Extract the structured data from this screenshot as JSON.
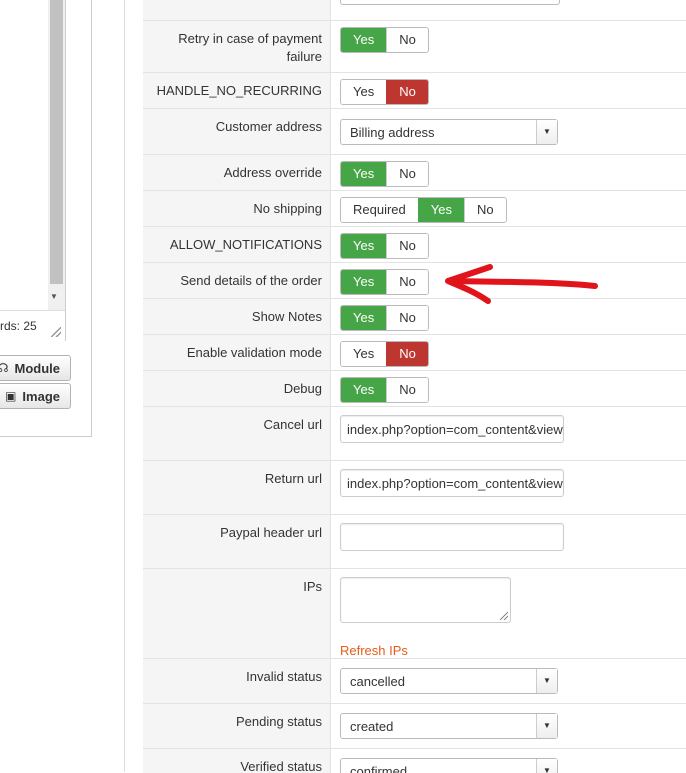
{
  "editor": {
    "words_text": "rds: 25",
    "buttons": [
      {
        "label": "Module",
        "icon": "module-icon"
      },
      {
        "label": "Image",
        "icon": "image-icon"
      }
    ]
  },
  "colors": {
    "yes_active": "#46a546",
    "no_active": "#bd362f",
    "annotation_arrow": "#e0141a",
    "link": "#e55e1a"
  },
  "form": {
    "retry": {
      "label": "Retry in case of payment failure",
      "options": [
        "Yes",
        "No"
      ],
      "selected": "Yes"
    },
    "handle_no_recurring": {
      "label": "HANDLE_NO_RECURRING",
      "options": [
        "Yes",
        "No"
      ],
      "selected": "No"
    },
    "customer_address": {
      "label": "Customer address",
      "value": "Billing address"
    },
    "address_override": {
      "label": "Address override",
      "options": [
        "Yes",
        "No"
      ],
      "selected": "Yes"
    },
    "no_shipping": {
      "label": "No shipping",
      "options": [
        "Required",
        "Yes",
        "No"
      ],
      "selected": "Yes"
    },
    "allow_notifications": {
      "label": "ALLOW_NOTIFICATIONS",
      "options": [
        "Yes",
        "No"
      ],
      "selected": "Yes"
    },
    "send_details": {
      "label": "Send details of the order",
      "options": [
        "Yes",
        "No"
      ],
      "selected": "Yes"
    },
    "show_notes": {
      "label": "Show Notes",
      "options": [
        "Yes",
        "No"
      ],
      "selected": "Yes"
    },
    "validation_mode": {
      "label": "Enable validation mode",
      "options": [
        "Yes",
        "No"
      ],
      "selected": "No"
    },
    "debug": {
      "label": "Debug",
      "options": [
        "Yes",
        "No"
      ],
      "selected": "Yes"
    },
    "cancel_url": {
      "label": "Cancel url",
      "value": "index.php?option=com_content&view=article"
    },
    "return_url": {
      "label": "Return url",
      "value": "index.php?option=com_content&view=article"
    },
    "paypal_header_url": {
      "label": "Paypal header url",
      "value": ""
    },
    "ips": {
      "label": "IPs",
      "value": "",
      "refresh_label": "Refresh IPs"
    },
    "invalid_status": {
      "label": "Invalid status",
      "value": "cancelled"
    },
    "pending_status": {
      "label": "Pending status",
      "value": "created"
    },
    "verified_status": {
      "label": "Verified status",
      "value": "confirmed"
    }
  }
}
